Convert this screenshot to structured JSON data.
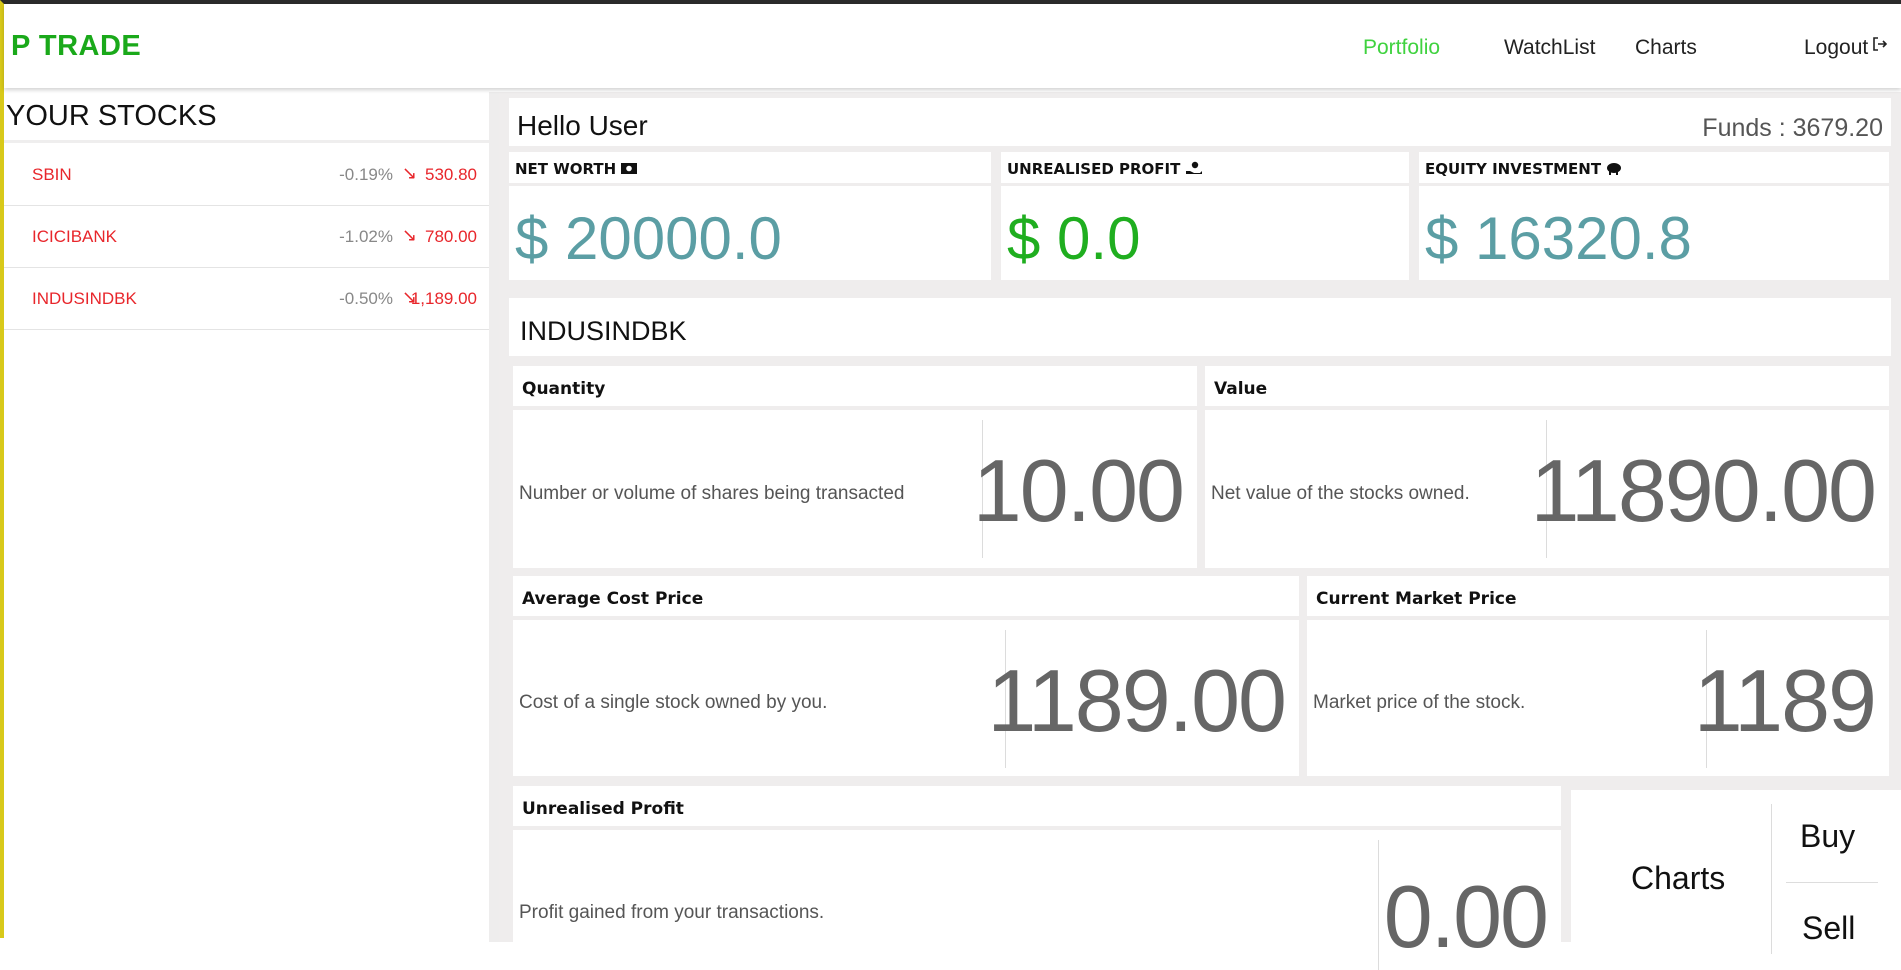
{
  "header": {
    "brand": "P TRADE",
    "nav": [
      "Portfolio",
      "WatchList",
      "Charts",
      "Logout"
    ]
  },
  "sidebar": {
    "title": "YOUR STOCKS",
    "stocks": [
      {
        "symbol": "SBIN",
        "change": "-0.19%",
        "arrow": "↘",
        "price": "530.80"
      },
      {
        "symbol": "ICICIBANK",
        "change": "-1.02%",
        "arrow": "↘",
        "price": "780.00"
      },
      {
        "symbol": "INDUSINDBK",
        "change": "-0.50%",
        "arrow": "↘",
        "price": "1,189.00"
      }
    ]
  },
  "overview": {
    "greeting": "Hello User",
    "funds": "Funds : 3679.20",
    "net_worth": {
      "label": "NET WORTH",
      "value": "$ 20000.0",
      "icon": "money-icon"
    },
    "unrealised": {
      "label": "UNREALISED PROFIT",
      "value": "$ 0.0",
      "icon": "hand-coin-icon"
    },
    "equity": {
      "label": "EQUITY INVESTMENT",
      "value": "$ 16320.8",
      "icon": "piggy-bank-icon"
    }
  },
  "detail": {
    "symbol": "INDUSINDBK",
    "quantity": {
      "label": "Quantity",
      "desc": "Number or volume of shares being transacted",
      "value": "10.00"
    },
    "value": {
      "label": "Value",
      "desc": "Net value of the stocks owned.",
      "value": "11890.00"
    },
    "avg_cost": {
      "label": "Average Cost Price",
      "desc": "Cost of a single stock owned by you.",
      "value": "1189.00"
    },
    "market_price": {
      "label": "Current Market Price",
      "desc": "Market price of the stock.",
      "value": "1189"
    },
    "profit": {
      "label": "Unrealised Profit",
      "desc": "Profit gained from your transactions.",
      "value": "0.00"
    }
  },
  "actions": {
    "charts": "Charts",
    "buy": "Buy",
    "sell": "Sell"
  },
  "colors": {
    "brand": "#1aa91a",
    "nav_active": "#3fd23f",
    "negative": "#e8262b",
    "teal": "#5b9ea4"
  }
}
